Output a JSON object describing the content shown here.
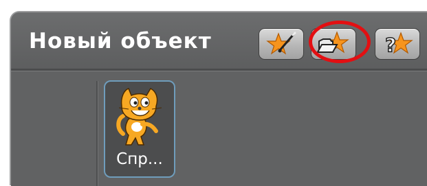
{
  "panel": {
    "title": "Новый объект"
  },
  "buttons": {
    "paint_new_sprite": {
      "icon": "paint-star-icon"
    },
    "choose_sprite_from_file": {
      "icon": "folder-star-icon",
      "highlighted": true,
      "highlight_color": "#e30f12"
    },
    "surprise_sprite": {
      "icon": "question-star-icon"
    }
  },
  "sprites": [
    {
      "label": "Спр...",
      "icon": "scratch-cat-icon",
      "selected": true
    }
  ],
  "colors": {
    "panel_background": "#616263",
    "button_face": "#c8c8c8",
    "star": "#f7941d",
    "selection_border": "#6f9dbc"
  }
}
